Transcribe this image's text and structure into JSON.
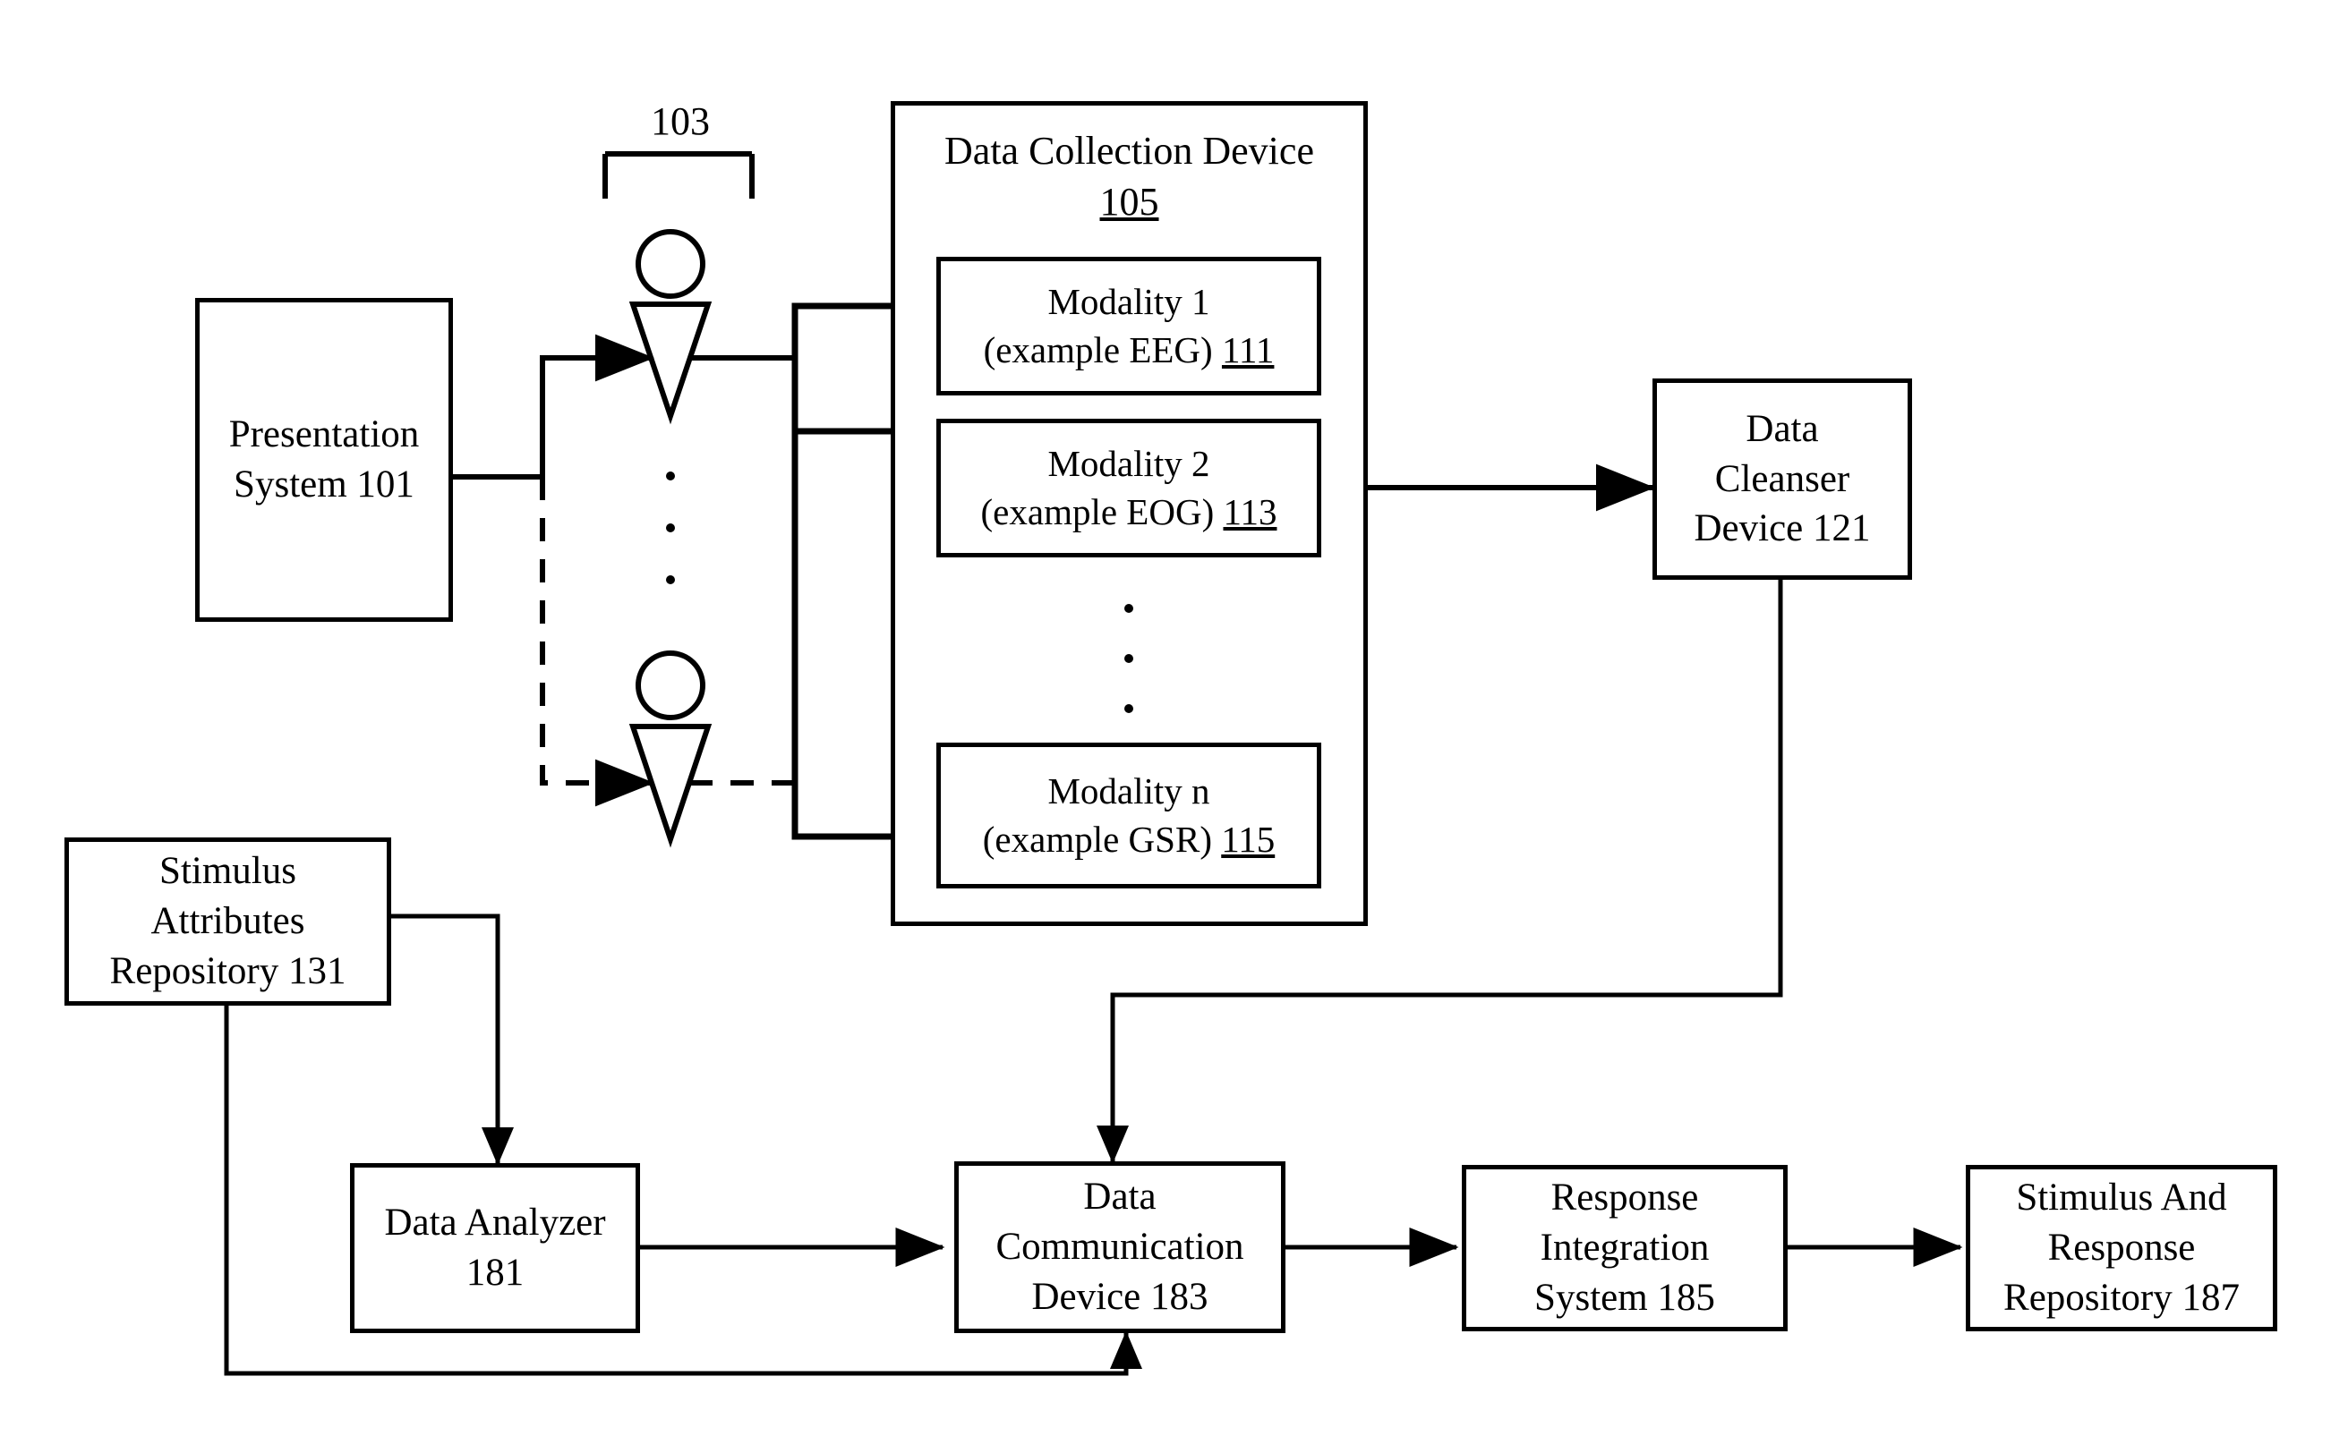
{
  "figure": {
    "type": "patent-block-diagram",
    "background": "#ffffff",
    "stroke": "#000000"
  },
  "labels": {
    "participants_ref": "103"
  },
  "boxes": {
    "presentation_system": {
      "lines": [
        "Presentation",
        "System 101"
      ]
    },
    "data_collection_device": {
      "title": "Data Collection Device",
      "ref": "105"
    },
    "modality_1": {
      "line1": "Modality 1",
      "line2_text": "(example EEG) ",
      "line2_ref": "111"
    },
    "modality_2": {
      "line1": "Modality 2",
      "line2_text": "(example EOG) ",
      "line2_ref": "113"
    },
    "modality_n": {
      "line1": "Modality n",
      "line2_text": "(example GSR) ",
      "line2_ref": "115"
    },
    "data_cleanser_device": {
      "lines": [
        "Data",
        "Cleanser",
        "Device 121"
      ]
    },
    "stimulus_attributes_repository": {
      "lines": [
        "Stimulus",
        "Attributes",
        "Repository 131"
      ]
    },
    "data_analyzer": {
      "lines": [
        "Data Analyzer",
        "181"
      ]
    },
    "data_communication_device": {
      "lines": [
        "Data",
        "Communication",
        "Device 183"
      ]
    },
    "response_integration_system": {
      "lines": [
        "Response",
        "Integration",
        "System 185"
      ]
    },
    "stimulus_and_response_repository": {
      "lines": [
        "Stimulus And",
        "Response",
        "Repository 187"
      ]
    }
  },
  "ellipses": {
    "participants_dots": "• • •",
    "modality_dots": "• • •"
  },
  "connections": [
    {
      "from": "presentation-system",
      "to": "participant-1",
      "style": "solid",
      "arrow": true
    },
    {
      "from": "presentation-system",
      "to": "participant-n",
      "style": "dashed",
      "arrow": true
    },
    {
      "from": "participant-1",
      "to": "data-collection-device",
      "style": "solid",
      "arrow": false
    },
    {
      "from": "participant-n",
      "to": "data-collection-device",
      "style": "dashed",
      "arrow": false
    },
    {
      "from": "data-collection-device",
      "to": "data-cleanser-device",
      "style": "solid",
      "arrow": true
    },
    {
      "from": "stimulus-attributes-repository",
      "to": "data-analyzer",
      "style": "solid",
      "arrow": true
    },
    {
      "from": "data-cleanser-device",
      "to": "data-communication-device",
      "style": "solid",
      "arrow": true
    },
    {
      "from": "data-analyzer",
      "to": "data-communication-device",
      "style": "solid",
      "arrow": true
    },
    {
      "from": "data-communication-device",
      "to": "response-integration-system",
      "style": "solid",
      "arrow": true
    },
    {
      "from": "response-integration-system",
      "to": "stimulus-and-response-repository",
      "style": "solid",
      "arrow": true
    },
    {
      "from": "stimulus-attributes-repository",
      "to": "data-communication-device",
      "style": "solid",
      "arrow": true
    }
  ]
}
